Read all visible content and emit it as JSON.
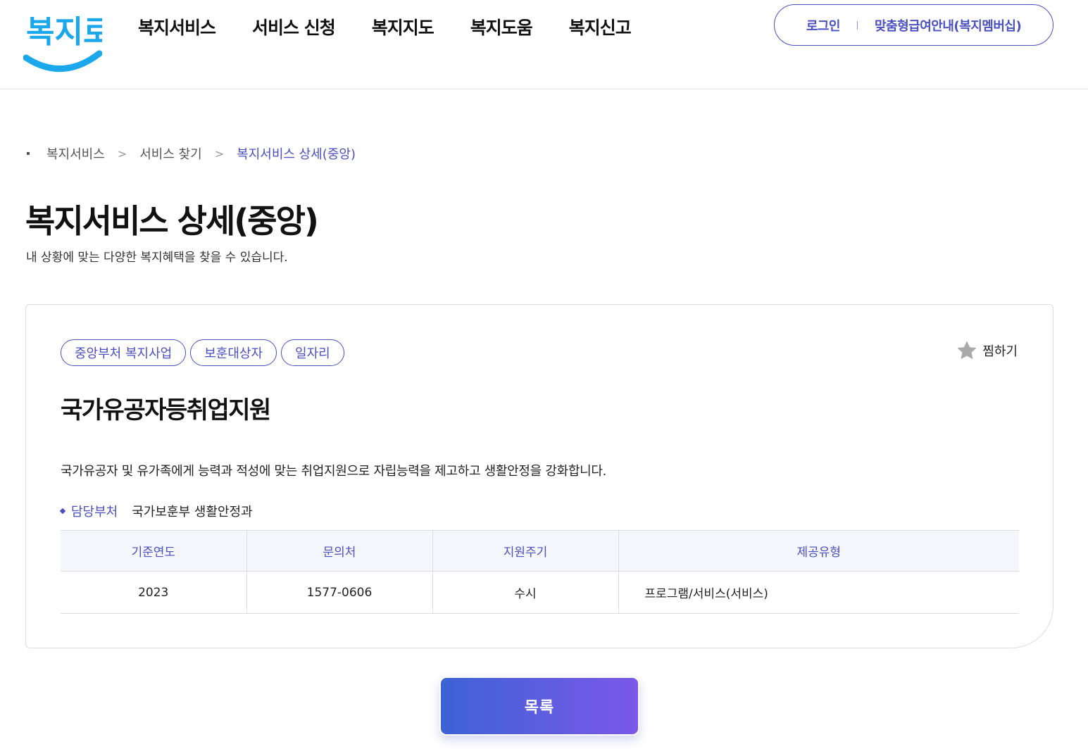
{
  "header": {
    "logo_text": "복지로",
    "nav": [
      {
        "label": "복지서비스"
      },
      {
        "label": "서비스 신청"
      },
      {
        "label": "복지지도"
      },
      {
        "label": "복지도움"
      },
      {
        "label": "복지신고"
      }
    ],
    "util": {
      "login": "로그인",
      "membership": "맞춤형급여안내(복지멤버십)"
    }
  },
  "breadcrumb": {
    "items": [
      "복지서비스",
      "서비스 찾기",
      "복지서비스 상세(중앙)"
    ]
  },
  "page": {
    "title": "복지서비스 상세(중앙)",
    "description": "내 상황에 맞는 다양한 복지혜택을 찾을 수 있습니다."
  },
  "service": {
    "tags": [
      "중앙부처 복지사업",
      "보훈대상자",
      "일자리"
    ],
    "favorite_label": "찜하기",
    "title": "국가유공자등취업지원",
    "summary": "국가유공자 및 유가족에게 능력과 적성에 맞는 취업지원으로 자립능력을 제고하고 생활안정을 강화합니다.",
    "department_label": "담당부처",
    "department_value": "국가보훈부 생활안정과",
    "table": {
      "headers": [
        "기준연도",
        "문의처",
        "지원주기",
        "제공유형"
      ],
      "row": [
        "2023",
        "1577-0606",
        "수시",
        "프로그램/서비스(서비스)"
      ]
    }
  },
  "footer": {
    "list_button": "목록"
  },
  "colors": {
    "accent": "#4a4fc2",
    "logo_blue": "#1aa7ec",
    "button_gradient_start": "#3d63d6",
    "button_gradient_end": "#7b58e8"
  }
}
